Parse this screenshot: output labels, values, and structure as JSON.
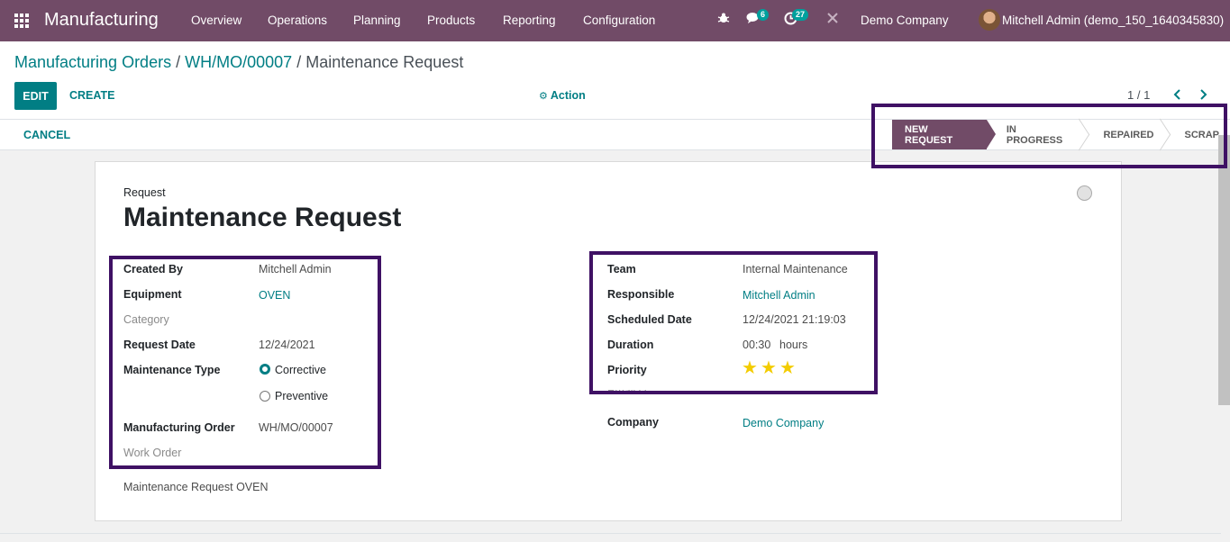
{
  "navbar": {
    "brand": "Manufacturing",
    "menu": [
      "Overview",
      "Operations",
      "Planning",
      "Products",
      "Reporting",
      "Configuration"
    ],
    "messages_count": "6",
    "activities_count": "27",
    "company": "Demo Company",
    "user": "Mitchell Admin (demo_150_1640345830)"
  },
  "breadcrumb": {
    "items": [
      "Manufacturing Orders",
      "WH/MO/00007",
      "Maintenance Request"
    ]
  },
  "toolbar": {
    "edit": "EDIT",
    "create": "CREATE",
    "action": "Action",
    "pager": "1 / 1"
  },
  "statusbar": {
    "cancel": "CANCEL",
    "stages": [
      "NEW REQUEST",
      "IN PROGRESS",
      "REPAIRED",
      "SCRAP"
    ],
    "active_stage": "NEW REQUEST"
  },
  "form": {
    "request_label": "Request",
    "title": "Maintenance Request",
    "left": {
      "created_by_label": "Created By",
      "created_by": "Mitchell Admin",
      "equipment_label": "Equipment",
      "equipment": "OVEN",
      "category_label": "Category",
      "request_date_label": "Request Date",
      "request_date": "12/24/2021",
      "maintenance_type_label": "Maintenance Type",
      "maintenance_types": [
        "Corrective",
        "Preventive"
      ],
      "maintenance_type_selected": "Corrective",
      "mo_label": "Manufacturing Order",
      "mo": "WH/MO/00007",
      "work_order_label": "Work Order"
    },
    "right": {
      "team_label": "Team",
      "team": "Internal Maintenance",
      "responsible_label": "Responsible",
      "responsible": "Mitchell Admin",
      "scheduled_label": "Scheduled Date",
      "scheduled": "12/24/2021 21:19:03",
      "duration_label": "Duration",
      "duration": "00:30",
      "duration_unit": "hours",
      "priority_label": "Priority",
      "priority_stars": 3,
      "email_cc_label": "Email cc",
      "company_label": "Company",
      "company": "Demo Company"
    },
    "description": "Maintenance Request OVEN"
  },
  "colors": {
    "navbar": "#714b67",
    "accent": "#017e84",
    "highlight": "#3f1164",
    "star": "#f3cc00"
  }
}
